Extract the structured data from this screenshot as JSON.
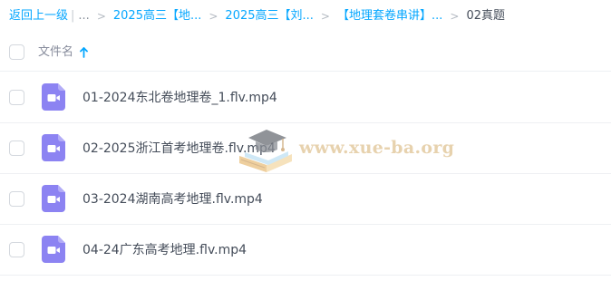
{
  "breadcrumb": {
    "back_label": "返回上一级",
    "ellipsis": "...",
    "separator": ">",
    "crumbs": [
      "2025高三【地...",
      "2025高三【刘...",
      "【地理套卷串讲】..."
    ],
    "current": "02真题"
  },
  "list_header": {
    "column_title": "文件名"
  },
  "files": [
    {
      "name": "01-2024东北卷地理卷_1.flv.mp4",
      "icon": "video-file-icon"
    },
    {
      "name": "02-2025浙江首考地理卷.flv.mp4",
      "icon": "video-file-icon"
    },
    {
      "name": "03-2024湖南高考地理.flv.mp4",
      "icon": "video-file-icon"
    },
    {
      "name": "04-24广东高考地理.flv.mp4",
      "icon": "video-file-icon"
    }
  ],
  "watermark": {
    "text": "www.xue-ba.org"
  },
  "colors": {
    "accent": "#06a7ff",
    "video_icon": "#8c83f2",
    "watermark": "#e2c79b"
  }
}
